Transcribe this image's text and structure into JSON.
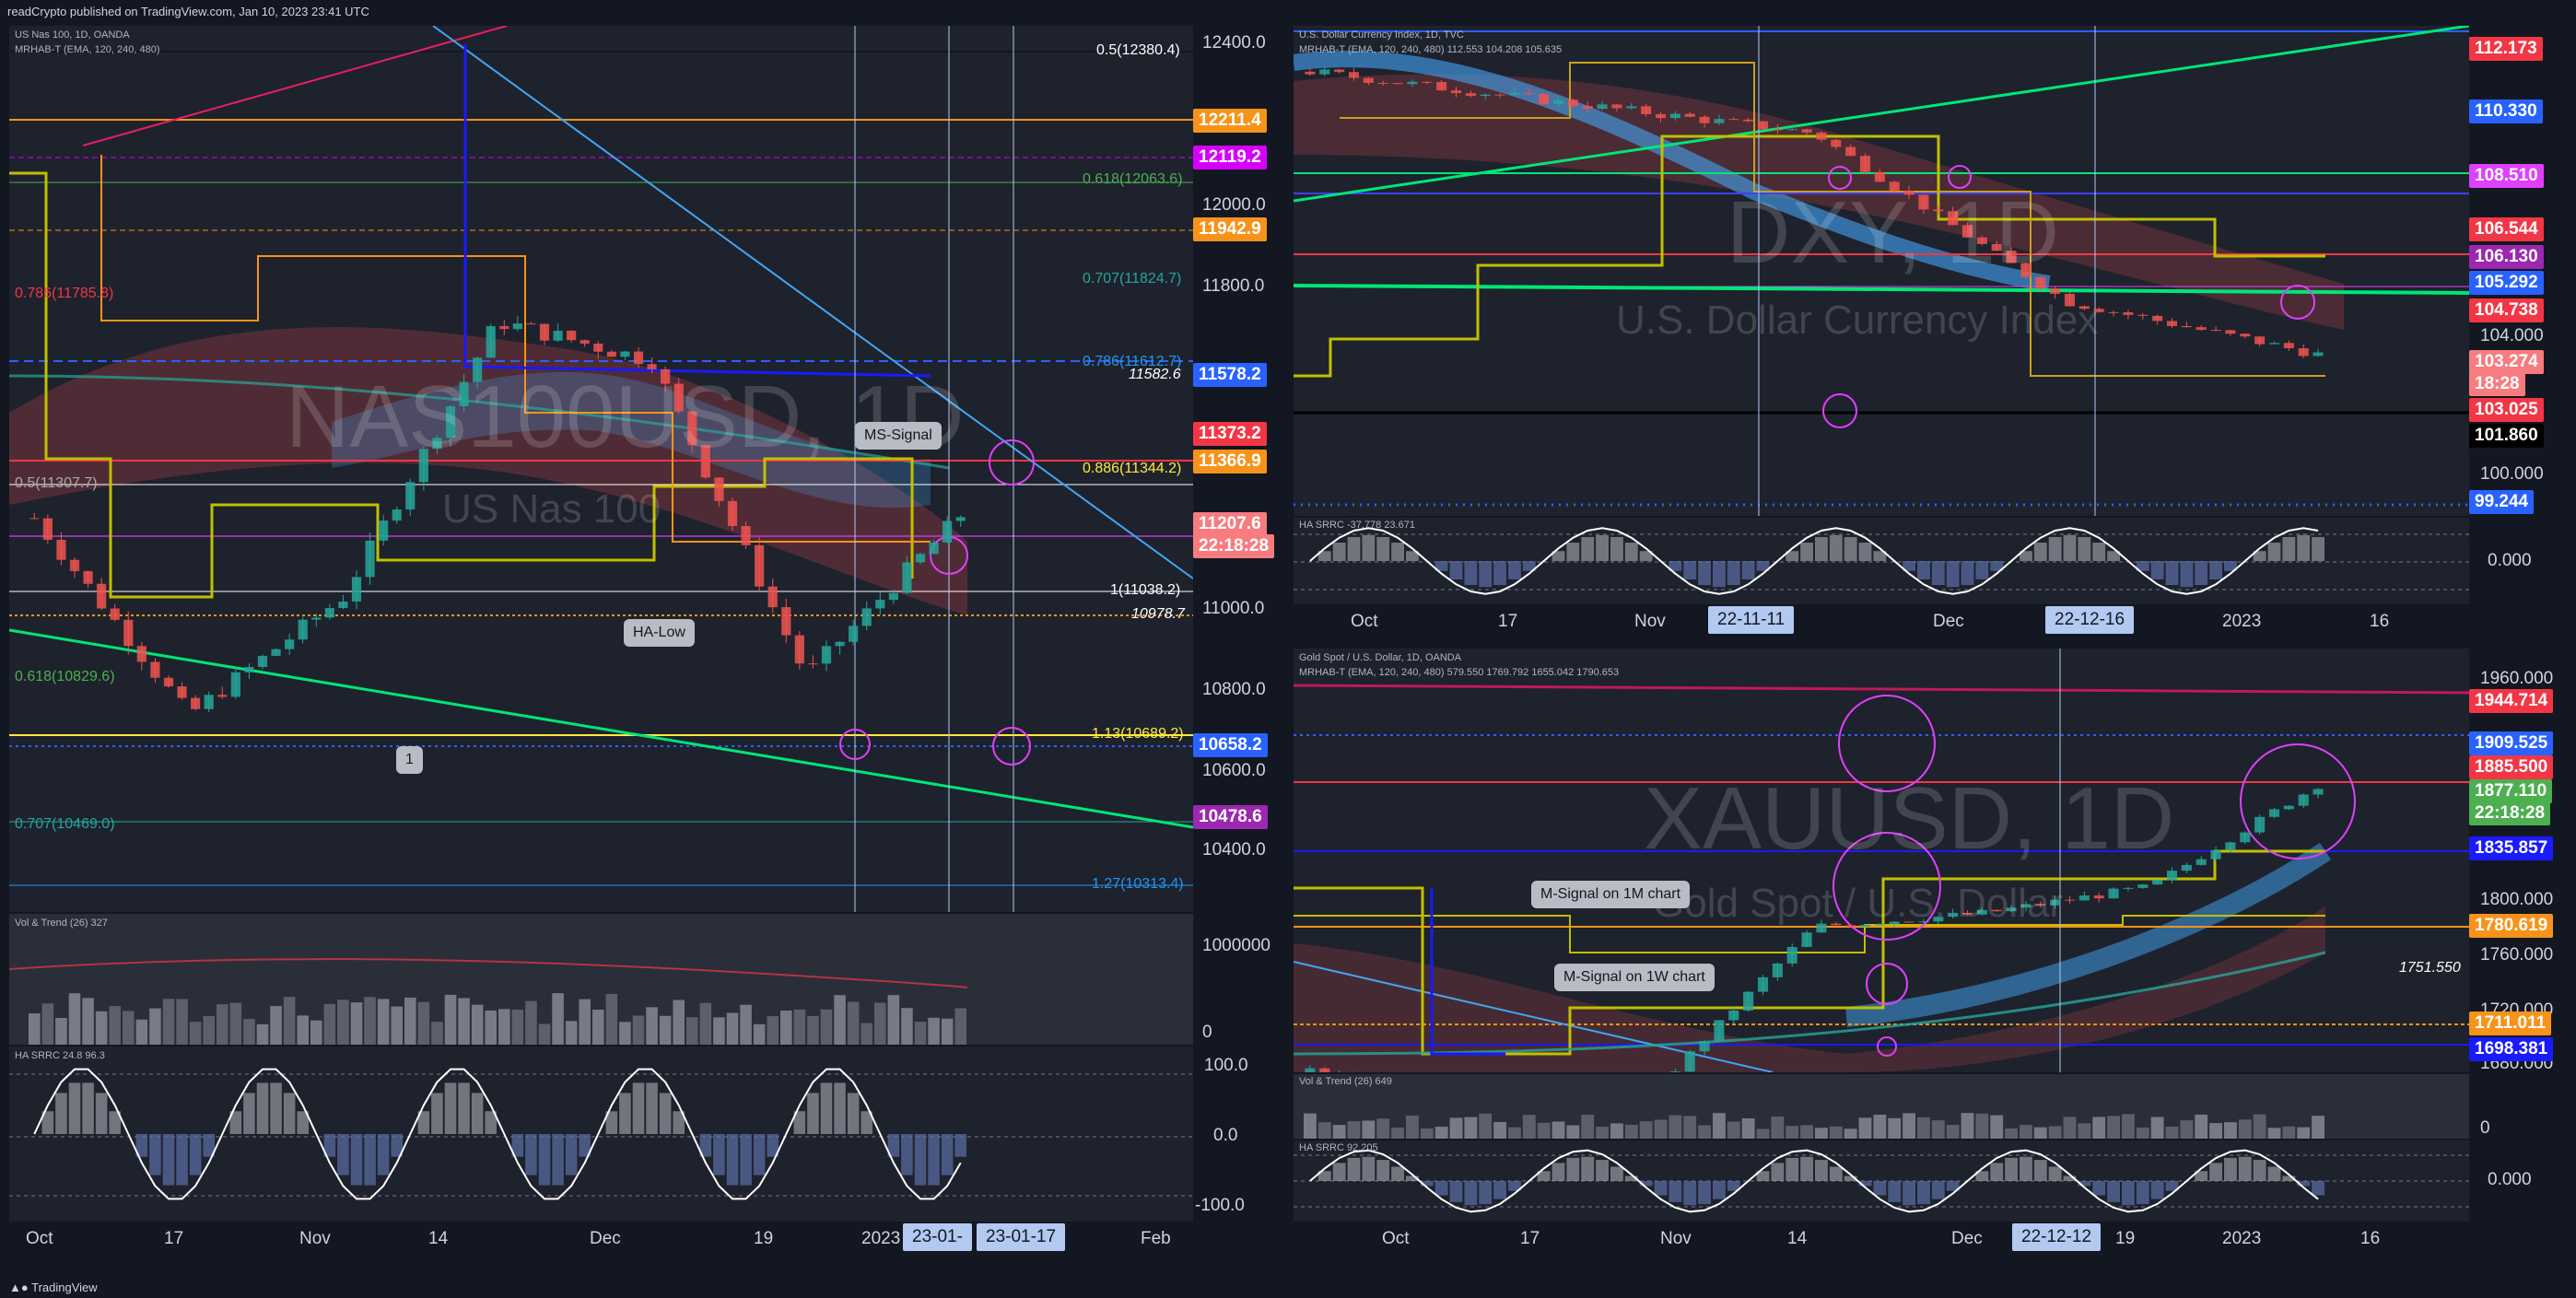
{
  "header": {
    "publisher_line": "readCrypto published on TradingView.com, Jan 10, 2023 23:41 UTC"
  },
  "footer": {
    "brand": "TradingView"
  },
  "panels": {
    "nas": {
      "legend1": "US Nas 100, 1D, OANDA",
      "legend2": "MRHAB-T (EMA, 120, 240, 480)",
      "watermark_symbol": "NAS100USD, 1D",
      "watermark_name": "US Nas 100",
      "yaxis": [
        "12400.0",
        "12000.0",
        "11800.0",
        "11000.0",
        "10800.0",
        "10600.0",
        "10400.0"
      ],
      "price_labels": [
        {
          "text": "12211.4",
          "color": "#f7931a"
        },
        {
          "text": "12119.2",
          "color": "#d500f9"
        },
        {
          "text": "11942.9",
          "color": "#f7931a"
        },
        {
          "text": "11578.2",
          "color": "#2962ff"
        },
        {
          "text": "11373.2",
          "color": "#f23645"
        },
        {
          "text": "11366.9",
          "color": "#f7931a"
        },
        {
          "text": "11207.6",
          "color": "#f77c80"
        },
        {
          "text": "22:18:28",
          "color": "#f77c80"
        },
        {
          "text": "10658.2",
          "color": "#2962ff"
        },
        {
          "text": "10478.6",
          "color": "#9c27b0"
        }
      ],
      "fibs": [
        {
          "text": "0.5(12380.4)",
          "color": "#131722"
        },
        {
          "text": "0.618(12063.6)",
          "color": "#4caf50"
        },
        {
          "text": "0.707(11824.7)",
          "color": "#26a69a"
        },
        {
          "text": "0.786(11612.7)",
          "color": "#2196f3"
        },
        {
          "text": "11582.6",
          "color": "#ffffff"
        },
        {
          "text": "0.886(11344.2)",
          "color": "#ffeb3b"
        },
        {
          "text": "1(11038.2)",
          "color": "#ffffff"
        },
        {
          "text": "10978.7",
          "color": "#ffffff"
        },
        {
          "text": "1.13(10689.2)",
          "color": "#ffeb3b"
        },
        {
          "text": "1.27(10313.4)",
          "color": "#2196f3"
        },
        {
          "text": "0.618(10829.6)",
          "color": "#4caf50"
        },
        {
          "text": "0.707(10469.0)",
          "color": "#26a69a"
        },
        {
          "text": "0.5(11307.7)",
          "color": "#aaaaaa"
        },
        {
          "text": "0.786(11785.8)",
          "color": "#f23645"
        }
      ],
      "callouts": [
        "MS-Signal",
        "HA-Low",
        "1"
      ],
      "vol_legend": "Vol & Trend (26)  327",
      "vol_axis": [
        "1000000",
        "0"
      ],
      "osc_legend": "HA SRRC  24.8  96.3",
      "osc_axis": [
        "100.0",
        "0.0",
        "-100.0"
      ],
      "xaxis": [
        "Oct",
        "17",
        "Nov",
        "14",
        "Dec",
        "19",
        "2023",
        "Feb"
      ],
      "xbadges": [
        "23-01-",
        "23-01-17"
      ]
    },
    "dxy": {
      "legend1": "U.S. Dollar Currency Index, 1D, TVC",
      "legend2": "MRHAB-T (EMA, 120, 240, 480)  112.553  104.208  105.635",
      "watermark_symbol": "DXY, 1D",
      "watermark_name": "U.S. Dollar Currency Index",
      "yaxis": [
        "104.000",
        "100.000"
      ],
      "price_labels": [
        {
          "text": "112.173",
          "color": "#f23645"
        },
        {
          "text": "110.330",
          "color": "#2962ff"
        },
        {
          "text": "108.510",
          "color": "#e040fb"
        },
        {
          "text": "106.544",
          "color": "#f23645"
        },
        {
          "text": "106.130",
          "color": "#9c27b0"
        },
        {
          "text": "105.292",
          "color": "#2962ff"
        },
        {
          "text": "104.738",
          "color": "#f23645"
        },
        {
          "text": "103.274",
          "color": "#f77c80"
        },
        {
          "text": "18:28",
          "color": "#f77c80"
        },
        {
          "text": "103.025",
          "color": "#f23645"
        },
        {
          "text": "101.860",
          "color": "#000000"
        },
        {
          "text": "99.244",
          "color": "#2962ff"
        }
      ],
      "osc_legend": "HA SRRC  -37.778  23.671",
      "osc_axis": [
        "0.000"
      ],
      "xaxis": [
        "Oct",
        "17",
        "Nov",
        "Dec",
        "2023",
        "16"
      ],
      "xbadges": [
        "22-11-11",
        "22-12-16"
      ]
    },
    "gold": {
      "legend1": "Gold Spot / U.S. Dollar, 1D, OANDA",
      "legend2": "MRHAB-T (EMA, 120, 240, 480)  579.550  1769.792  1655.042  1790.653",
      "watermark_symbol": "XAUUSD, 1D",
      "watermark_name": "Gold Spot / U.S. Dollar",
      "yaxis": [
        "1960.000",
        "1800.000",
        "1760.000",
        "1720.000",
        "1680.000"
      ],
      "price_labels": [
        {
          "text": "1944.714",
          "color": "#f23645"
        },
        {
          "text": "1909.525",
          "color": "#2962ff"
        },
        {
          "text": "1885.500",
          "color": "#f23645"
        },
        {
          "text": "1877.110",
          "color": "#4caf50"
        },
        {
          "text": "22:18:28",
          "color": "#4caf50"
        },
        {
          "text": "1835.857",
          "color": "#1a1aff"
        },
        {
          "text": "1780.619",
          "color": "#f7931a"
        },
        {
          "text": "1711.011",
          "color": "#f7931a"
        },
        {
          "text": "1698.381",
          "color": "#1a1aff"
        }
      ],
      "fib_text": "1751.550",
      "callouts": [
        "M-Signal on 1M chart",
        "M-Signal on 1W chart"
      ],
      "vol_legend": "Vol & Trend (26)  649",
      "osc_legend": "HA SRRC  92.205",
      "vol_axis": [
        "0"
      ],
      "osc_axis": [
        "0.000"
      ],
      "xaxis": [
        "Oct",
        "17",
        "Nov",
        "14",
        "Dec",
        "19",
        "2023",
        "16"
      ],
      "xbadges": [
        "22-12-12"
      ]
    }
  },
  "chart_data": [
    {
      "type": "line",
      "title": "NAS100USD, 1D",
      "xlabel": "",
      "ylabel": "",
      "ylim": [
        10200,
        12450
      ],
      "x": [
        "Oct",
        "17",
        "Nov",
        "14",
        "Dec",
        "19",
        "2023"
      ],
      "series": [
        {
          "name": "US Nas 100",
          "values": [
            11200,
            10700,
            11000,
            11700,
            11600,
            10800,
            11207.6
          ]
        }
      ],
      "grid": true
    },
    {
      "type": "line",
      "title": "DXY, 1D",
      "xlabel": "",
      "ylabel": "",
      "ylim": [
        98,
        114
      ],
      "x": [
        "Oct",
        "17",
        "Nov",
        "Dec",
        "2023"
      ],
      "series": [
        {
          "name": "U.S. Dollar Currency Index",
          "values": [
            112.5,
            111.5,
            110.5,
            105.0,
            103.274
          ]
        }
      ],
      "grid": true
    },
    {
      "type": "line",
      "title": "XAUUSD, 1D",
      "xlabel": "",
      "ylabel": "",
      "ylim": [
        1660,
        1980
      ],
      "x": [
        "Oct",
        "17",
        "Nov",
        "14",
        "Dec",
        "19",
        "2023"
      ],
      "series": [
        {
          "name": "Gold Spot / U.S. Dollar",
          "values": [
            1660,
            1640,
            1640,
            1770,
            1780,
            1800,
            1877.11
          ]
        }
      ],
      "grid": true
    }
  ]
}
